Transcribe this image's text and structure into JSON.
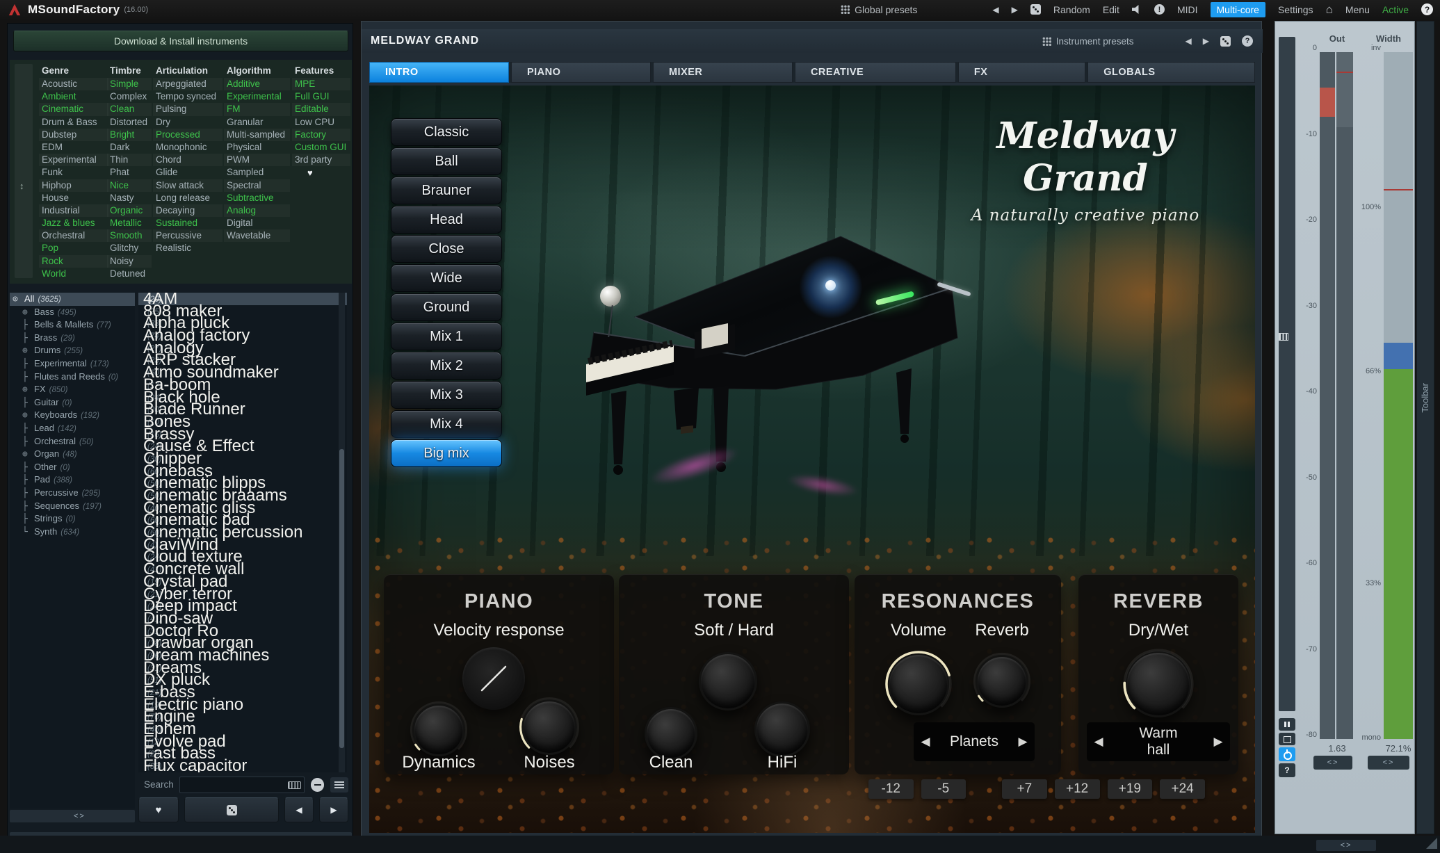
{
  "topbar": {
    "app_title": "MSoundFactory",
    "version": "(16.00)",
    "global_presets_label": "Global presets",
    "random_label": "Random",
    "edit_label": "Edit",
    "midi_label": "MIDI",
    "multicore_label": "Multi-core",
    "settings_label": "Settings",
    "menu_label": "Menu",
    "active_label": "Active",
    "help_label": "?",
    "exclaim_label": "!"
  },
  "icons": {
    "prev": "◀",
    "next": "▶",
    "heart": "♥",
    "updown": "↕",
    "home": "⌂",
    "resize": "<>",
    "question": "?"
  },
  "sidebar": {
    "download_button": "Download & Install instruments",
    "search_label": "Search",
    "search_value": "",
    "filters": {
      "genre": {
        "header": "Genre",
        "items": [
          "Acoustic",
          {
            "label": "Ambient",
            "cls": "on"
          },
          {
            "label": "Cinematic",
            "cls": "on"
          },
          "Drum & Bass",
          "Dubstep",
          "EDM",
          "Experimental",
          "Funk",
          "Hiphop",
          "House",
          "Industrial",
          {
            "label": "Jazz & blues",
            "cls": "on"
          },
          "Orchestral",
          {
            "label": "Pop",
            "cls": "on"
          },
          {
            "label": "Rock",
            "cls": "on"
          },
          {
            "label": "World",
            "cls": "on"
          }
        ]
      },
      "timbre": {
        "header": "Timbre",
        "items": [
          {
            "label": "Simple",
            "cls": "on"
          },
          "Complex",
          {
            "label": "Clean",
            "cls": "on"
          },
          "Distorted",
          {
            "label": "Bright",
            "cls": "on"
          },
          "Dark",
          "Thin",
          "Phat",
          {
            "label": "Nice",
            "cls": "on"
          },
          "Nasty",
          {
            "label": "Organic",
            "cls": "on"
          },
          {
            "label": "Metallic",
            "cls": "on"
          },
          {
            "label": "Smooth",
            "cls": "on"
          },
          "Glitchy",
          "Noisy",
          "Detuned"
        ]
      },
      "articulation": {
        "header": "Articulation",
        "items": [
          "Arpeggiated",
          "Tempo synced",
          "Pulsing",
          "Dry",
          {
            "label": "Processed",
            "cls": "on"
          },
          "Monophonic",
          "Chord",
          "Glide",
          "Slow attack",
          "Long release",
          "Decaying",
          {
            "label": "Sustained",
            "cls": "on"
          },
          "Percussive",
          "Realistic"
        ]
      },
      "algorithm": {
        "header": "Algorithm",
        "items": [
          {
            "label": "Additive",
            "cls": "on"
          },
          {
            "label": "Experimental",
            "cls": "on"
          },
          {
            "label": "FM",
            "cls": "on"
          },
          "Granular",
          "Multi-sampled",
          "Physical",
          "PWM",
          "Sampled",
          "Spectral",
          {
            "label": "Subtractive",
            "cls": "on"
          },
          {
            "label": "Analog",
            "cls": "on"
          },
          "Digital",
          "Wavetable"
        ]
      },
      "features": {
        "header": "Features",
        "items": [
          {
            "label": "MPE",
            "cls": "on"
          },
          {
            "label": "Full GUI",
            "cls": "on"
          },
          {
            "label": "Editable",
            "cls": "on"
          },
          "Low CPU",
          {
            "label": "Factory",
            "cls": "on"
          },
          {
            "label": "Custom GUI",
            "cls": "on"
          },
          "3rd party"
        ]
      }
    },
    "tree": {
      "items": [
        {
          "icon": "⊙",
          "label": "All",
          "count": "(3625)",
          "cls": "sel root"
        },
        {
          "icon": "⊕",
          "label": "Bass",
          "count": "(495)"
        },
        {
          "icon": "├",
          "label": "Bells & Mallets",
          "count": "(77)"
        },
        {
          "icon": "├",
          "label": "Brass",
          "count": "(29)"
        },
        {
          "icon": "⊕",
          "label": "Drums",
          "count": "(255)"
        },
        {
          "icon": "├",
          "label": "Experimental",
          "count": "(173)"
        },
        {
          "icon": "├",
          "label": "Flutes and Reeds",
          "count": "(0)"
        },
        {
          "icon": "⊕",
          "label": "FX",
          "count": "(850)"
        },
        {
          "icon": "├",
          "label": "Guitar",
          "count": "(0)"
        },
        {
          "icon": "⊕",
          "label": "Keyboards",
          "count": "(192)"
        },
        {
          "icon": "├",
          "label": "Lead",
          "count": "(142)"
        },
        {
          "icon": "├",
          "label": "Orchestral",
          "count": "(50)"
        },
        {
          "icon": "⊕",
          "label": "Organ",
          "count": "(48)"
        },
        {
          "icon": "├",
          "label": "Other",
          "count": "(0)"
        },
        {
          "icon": "├",
          "label": "Pad",
          "count": "(388)"
        },
        {
          "icon": "├",
          "label": "Percussive",
          "count": "(295)"
        },
        {
          "icon": "├",
          "label": "Sequences",
          "count": "(197)"
        },
        {
          "icon": "├",
          "label": "Strings",
          "count": "(0)"
        },
        {
          "icon": "└",
          "label": "Synth",
          "count": "(634)"
        }
      ]
    },
    "presets": {
      "items": [
        {
          "label": "4AM",
          "count": "(20)",
          "cls": "sel"
        },
        {
          "label": "808 maker",
          "count": "(25)"
        },
        {
          "label": "Alpha pluck",
          "count": "(33)"
        },
        {
          "label": "Analog factory",
          "count": "(74)"
        },
        {
          "label": "Analogy",
          "count": "(27)"
        },
        {
          "label": "ARP stacker",
          "count": "(23)"
        },
        {
          "label": "Atmo soundmaker",
          "count": "(60)"
        },
        {
          "label": "Ba-boom",
          "count": "(17)"
        },
        {
          "label": "Black hole",
          "count": "(24)"
        },
        {
          "label": "Blade Runner",
          "count": "(20)"
        },
        {
          "label": "Bones",
          "count": "(10)"
        },
        {
          "label": "Brassy",
          "count": "(16)"
        },
        {
          "label": "Cause & Effect",
          "count": "(24)"
        },
        {
          "label": "Chipper",
          "count": "(30)"
        },
        {
          "label": "Cinebass",
          "count": "(60)"
        },
        {
          "label": "Cinematic blipps",
          "count": "(50)"
        },
        {
          "label": "Cinematic braaams",
          "count": "(50)"
        },
        {
          "label": "Cinematic gliss",
          "count": "(40)"
        },
        {
          "label": "Cinematic pad",
          "count": "(60)"
        },
        {
          "label": "Cinematic percussion",
          "count": "(60)"
        },
        {
          "label": "ClaviWind",
          "count": "(4)"
        },
        {
          "label": "Cloud texture",
          "count": "(24)"
        },
        {
          "label": "Concrete wall",
          "count": "(41)"
        },
        {
          "label": "Crystal pad",
          "count": "(19)"
        },
        {
          "label": "Cyber terror",
          "count": "(21)"
        },
        {
          "label": "Deep impact",
          "count": "(24)"
        },
        {
          "label": "Dino-saw",
          "count": "(41)"
        },
        {
          "label": "Doctor Ro",
          "count": "(31)"
        },
        {
          "label": "Drawbar organ",
          "count": "(18)"
        },
        {
          "label": "Dream machines",
          "count": "(86)"
        },
        {
          "label": "Dreams",
          "count": "(31)"
        },
        {
          "label": "DX pluck",
          "count": "(51)"
        },
        {
          "label": "E-bass",
          "count": "(21)"
        },
        {
          "label": "Electric piano",
          "count": "(19)"
        },
        {
          "label": "Engine",
          "count": "(70)"
        },
        {
          "label": "Ephem",
          "count": "(46)"
        },
        {
          "label": "Evolve pad",
          "count": "(12)"
        },
        {
          "label": "Fast bass",
          "count": "(20)"
        },
        {
          "label": "Flux capacitor",
          "count": "(35)"
        }
      ]
    }
  },
  "main": {
    "title": "MELDWAY GRAND",
    "instrument_presets_label": "Instrument presets",
    "tabs": [
      {
        "label": "INTRO",
        "cls": "active t1"
      },
      {
        "label": "PIANO",
        "cls": "t2"
      },
      {
        "label": "MIXER",
        "cls": "t3"
      },
      {
        "label": "CREATIVE",
        "cls": "t4"
      },
      {
        "label": "FX",
        "cls": "t5"
      },
      {
        "label": "GLOBALS",
        "cls": "t6"
      }
    ],
    "scene": {
      "title": "Meldway Grand",
      "subtitle": "A naturally creative piano",
      "mic_buttons": [
        "Classic",
        "Ball",
        "Brauner",
        "Head",
        "Close",
        "Wide",
        "Ground",
        "Mix 1",
        "Mix 2",
        "Mix 3",
        "Mix 4",
        {
          "label": "Big mix",
          "cls": "active"
        }
      ]
    },
    "panels": {
      "piano": {
        "title": "PIANO",
        "param_label": "Velocity response",
        "knob1_label": "Dynamics",
        "knob2_label": "Noises"
      },
      "tone": {
        "title": "TONE",
        "param_label": "Soft / Hard",
        "knob1_label": "Clean",
        "knob2_label": "HiFi"
      },
      "resonances": {
        "title": "RESONANCES",
        "knob1_label": "Volume",
        "knob2_label": "Reverb",
        "selector_value": "Planets",
        "buttons": [
          "-12",
          "-5"
        ]
      },
      "reverb": {
        "title": "REVERB",
        "param_label": "Dry/Wet",
        "selector_value": "Warm hall",
        "buttons": [
          "+7",
          "+12",
          "+19",
          "+24"
        ]
      }
    }
  },
  "meter": {
    "out_label": "Out",
    "width_label": "Width",
    "db_ticks": [
      "0",
      "-10",
      "-20",
      "-30",
      "-40",
      "-50",
      "-60",
      "-70",
      "-80"
    ],
    "width_ticks": [
      "inv",
      "100%",
      "66%",
      "33%",
      "mono"
    ],
    "out_value": "1.63",
    "width_value": "72.1%",
    "toolbar_label": "Toolbar"
  },
  "colors": {
    "accent_blue": "#1e9cf0",
    "selected_green": "#3ec24b",
    "meter_red": "#b8554a",
    "meter_green": "#5f9e3c",
    "meter_blue": "#4371b0"
  }
}
